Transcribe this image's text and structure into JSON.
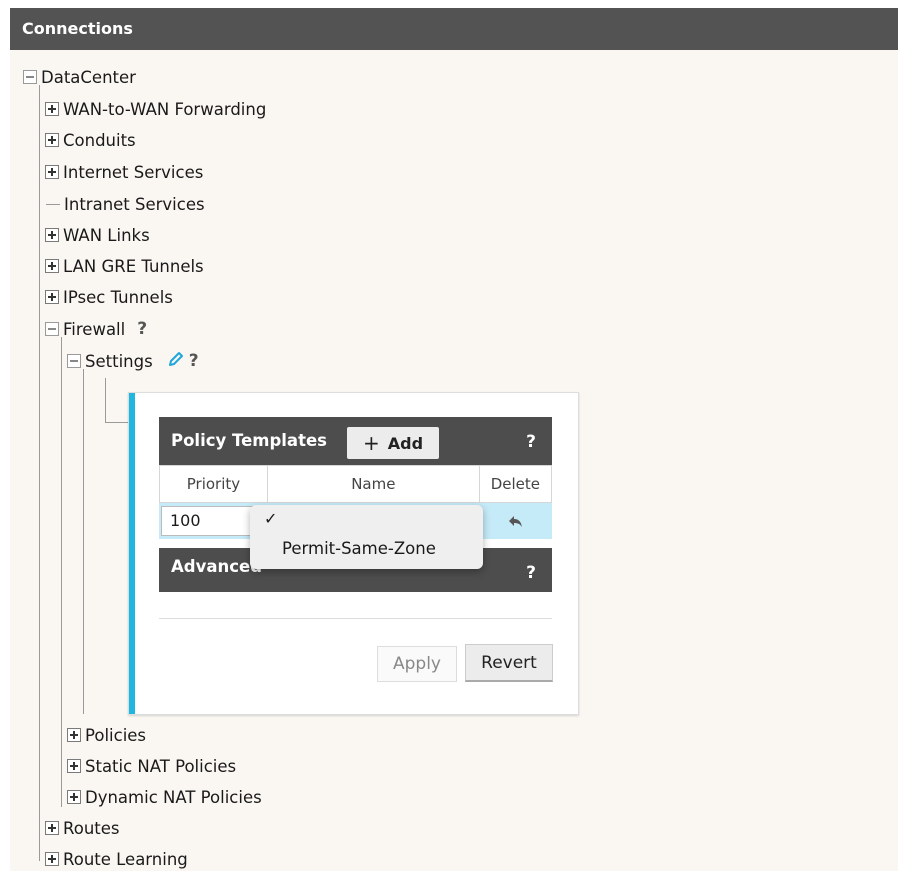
{
  "header": {
    "title": "Connections"
  },
  "tree": {
    "root": "DataCenter",
    "items": [
      "WAN-to-WAN Forwarding",
      "Conduits",
      "Internet Services",
      "Intranet Services",
      "WAN Links",
      "LAN GRE Tunnels",
      "IPsec Tunnels",
      "Firewall"
    ],
    "firewall_help": "?",
    "settings": "Settings",
    "settings_help": "?",
    "firewall_children": [
      "Policies",
      "Static NAT Policies",
      "Dynamic NAT Policies"
    ],
    "after": [
      "Routes",
      "Route Learning"
    ]
  },
  "panel": {
    "policy_templates_title": "Policy Templates",
    "add_label": "Add",
    "add_icon": "+",
    "help": "?",
    "columns": {
      "priority": "Priority",
      "name": "Name",
      "delete": "Delete"
    },
    "row": {
      "priority": "100",
      "name": "",
      "delete_icon": "undo-icon"
    },
    "advanced_title": "Advanced",
    "advanced_help": "?",
    "apply_label": "Apply",
    "revert_label": "Revert"
  },
  "dropdown": {
    "checkmark": "✓",
    "options": [
      "",
      "Permit-Same-Zone"
    ],
    "selected_index": 0
  },
  "colors": {
    "header_bg": "#535353",
    "accent": "#1fb6e0",
    "row_highlight": "#c5eaf8",
    "pencil": "#1fa7d8"
  }
}
